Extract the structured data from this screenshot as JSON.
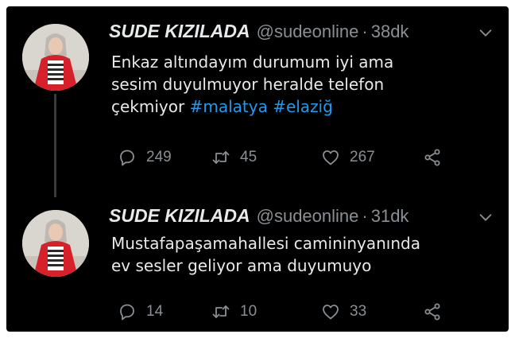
{
  "colors": {
    "background": "#000000",
    "text": "#e7e9ea",
    "secondary": "#8a8f94",
    "hashtag": "#1d9bf0",
    "frame": "#ffffff"
  },
  "tweets": [
    {
      "display_name": "SUDE KIZILADA",
      "handle": "@sudeonline",
      "separator": "·",
      "time": "38dk",
      "text_lines": [
        "Enkaz altındayım durumum iyi ama",
        "sesim duyulmuyor heralde telefon",
        "çekmiyor"
      ],
      "hashtags": [
        "#malatya",
        "#elaziğ"
      ],
      "replies": "249",
      "retweets": "45",
      "likes": "267",
      "icons": [
        "reply-icon",
        "retweet-icon",
        "like-icon",
        "share-icon",
        "chevron-down-icon"
      ]
    },
    {
      "display_name": "SUDE KIZILADA",
      "handle": "@sudeonline",
      "separator": "·",
      "time": "31dk",
      "text_lines": [
        "Mustafapaşamahallesi camininyanında",
        "ev sesler geliyor ama duyumuyo"
      ],
      "replies": "14",
      "retweets": "10",
      "likes": "33",
      "icons": [
        "reply-icon",
        "retweet-icon",
        "like-icon",
        "share-icon",
        "chevron-down-icon"
      ]
    }
  ]
}
